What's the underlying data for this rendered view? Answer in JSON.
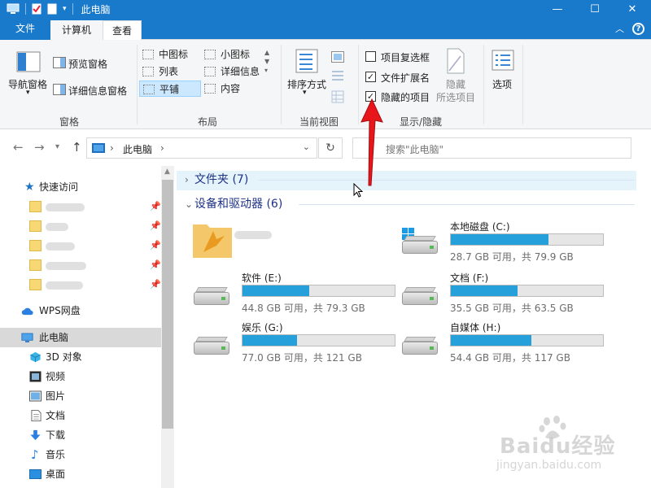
{
  "window": {
    "title": "此电脑",
    "minimize": "—",
    "maximize": "☐",
    "close": "✕"
  },
  "tabs": {
    "file": "文件",
    "computer": "计算机",
    "view": "查看",
    "help": "?"
  },
  "ribbon": {
    "panes": {
      "nav_pane": "导航窗格",
      "preview_pane": "预览窗格",
      "details_pane": "详细信息窗格",
      "group_title": "窗格"
    },
    "layout": {
      "items": [
        "中图标",
        "小图标",
        "列表",
        "详细信息",
        "平铺",
        "内容"
      ],
      "group_title": "布局"
    },
    "current_view": {
      "sort": "排序方式",
      "group_title": "当前视图"
    },
    "show_hide": {
      "item_checkbox": "项目复选框",
      "file_ext": "文件扩展名",
      "hidden_items": "隐藏的项目",
      "hide_selected_1": "隐藏",
      "hide_selected_2": "所选项目",
      "group_title": "显示/隐藏"
    },
    "options": "选项"
  },
  "address": {
    "path": "此电脑",
    "search_placeholder": "搜索\"此电脑\""
  },
  "nav_pane": {
    "quick_access": "快速访问",
    "wps": "WPS网盘",
    "this_pc": "此电脑",
    "items": [
      "3D 对象",
      "视频",
      "图片",
      "文档",
      "下载",
      "音乐",
      "桌面"
    ]
  },
  "content": {
    "folders_group": "文件夹 (7)",
    "devices_group": "设备和驱动器 (6)",
    "drives": [
      {
        "name": "本地磁盘 (C:)",
        "info": "28.7 GB 可用，共 79.9 GB",
        "used_pct": 64
      },
      {
        "name": "软件 (E:)",
        "info": "44.8 GB 可用，共 79.3 GB",
        "used_pct": 44
      },
      {
        "name": "文档 (F:)",
        "info": "35.5 GB 可用，共 63.5 GB",
        "used_pct": 44
      },
      {
        "name": "娱乐 (G:)",
        "info": "77.0 GB 可用，共 121 GB",
        "used_pct": 36
      },
      {
        "name": "自媒体 (H:)",
        "info": "54.4 GB 可用，共 117 GB",
        "used_pct": 53
      }
    ]
  },
  "watermark": {
    "brand": "Baidu经验",
    "url": "jingyan.baidu.com"
  },
  "colors": {
    "accent": "#1979ca",
    "arrow": "#e8161b",
    "bar_fill": "#26a0da"
  }
}
